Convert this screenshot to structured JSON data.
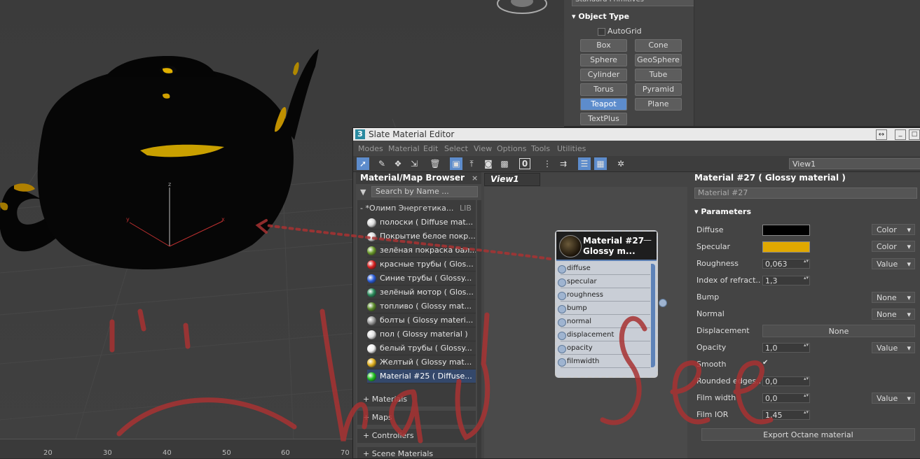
{
  "ruler": {
    "labels": [
      "20",
      "30",
      "40",
      "50",
      "60",
      "70"
    ]
  },
  "command_panel": {
    "primitives_dropdown": "Standard Primitives",
    "object_type_header": "Object Type",
    "autogrid_label": "AutoGrid",
    "buttons": [
      {
        "label": "Box",
        "active": false
      },
      {
        "label": "Cone",
        "active": false
      },
      {
        "label": "Sphere",
        "active": false
      },
      {
        "label": "GeoSphere",
        "active": false
      },
      {
        "label": "Cylinder",
        "active": false
      },
      {
        "label": "Tube",
        "active": false
      },
      {
        "label": "Torus",
        "active": false
      },
      {
        "label": "Pyramid",
        "active": false
      },
      {
        "label": "Teapot",
        "active": true
      },
      {
        "label": "Plane",
        "active": false
      },
      {
        "label": "TextPlus",
        "active": false
      }
    ]
  },
  "slate": {
    "app_icon": "3",
    "title": "Slate Material Editor",
    "menu": [
      "Modes",
      "Material",
      "Edit",
      "Select",
      "View",
      "Options",
      "Tools",
      "Utilities"
    ],
    "toolbar_icons": [
      "select-arrow-icon",
      "eyedropper-icon",
      "pick-material-icon",
      "assign-material-icon",
      "delete-icon",
      "move-children-icon",
      "hide-unused-icon",
      "show-map-icon",
      "background-icon",
      "zero-icon",
      "layout-icon",
      "layout-children-icon",
      "material-map-browser-icon",
      "parameter-editor-icon",
      "select-by-material-icon"
    ],
    "view_dropdown": "View1",
    "browser": {
      "title": "Material/Map Browser",
      "search_placeholder": "Search by Name ...",
      "library_name": "- *Олимп Энергетика...",
      "library_tag": "LIB",
      "items": [
        {
          "label": "полоски  ( Diffuse mat...",
          "color": "#d8d8d8",
          "selected": false
        },
        {
          "label": "Покрытие белое покр...",
          "color": "#dcdcdc",
          "selected": false
        },
        {
          "label": "зелёная покраска бал...",
          "color": "#6a9a2a",
          "selected": false
        },
        {
          "label": "красные трубы  ( Glos...",
          "color": "#d82020",
          "selected": false
        },
        {
          "label": "Синие трубы  ( Glossy...",
          "color": "#2a5cd8",
          "selected": false
        },
        {
          "label": "зелёный мотор  ( Glos...",
          "color": "#2a8a5a",
          "selected": false
        },
        {
          "label": "топливо  ( Glossy mat...",
          "color": "#5a8a2a",
          "selected": false
        },
        {
          "label": "болты  ( Glossy materi...",
          "color": "#9a9a9a",
          "selected": false
        },
        {
          "label": "пол  ( Glossy material )",
          "color": "#e0e0e0",
          "selected": false
        },
        {
          "label": "белый трубы  ( Glossy...",
          "color": "#eeeeee",
          "selected": false
        },
        {
          "label": "Желтый  ( Glossy mat...",
          "color": "#e0b020",
          "selected": false
        },
        {
          "label": "Material #25  ( Diffuse...",
          "color": "#20c020",
          "selected": true
        }
      ],
      "sections": [
        "+ Materials",
        "+ Maps",
        "+ Controllers",
        "+ Scene Materials"
      ]
    },
    "view_tab": "View1",
    "node": {
      "title_line1": "Material #27",
      "title_line2": "Glossy m...",
      "minimize": "—",
      "slots": [
        "diffuse",
        "specular",
        "roughness",
        "bump",
        "normal",
        "displacement",
        "opacity",
        "filmwidth"
      ]
    },
    "params": {
      "title": "Material #27  ( Glossy material )",
      "name_field": "Material #27",
      "section": "Parameters",
      "rows": {
        "diffuse": {
          "label": "Diffuse",
          "color": "#000000",
          "mode": "Color"
        },
        "specular": {
          "label": "Specular",
          "color": "#e0a800",
          "mode": "Color"
        },
        "roughness": {
          "label": "Roughness",
          "value": "0,063",
          "mode": "Value"
        },
        "ior": {
          "label": "Index of refract...",
          "value": "1,3"
        },
        "bump": {
          "label": "Bump",
          "mode": "None"
        },
        "normal": {
          "label": "Normal",
          "mode": "None"
        },
        "displacement": {
          "label": "Displacement",
          "button": "None"
        },
        "opacity": {
          "label": "Opacity",
          "value": "1,0",
          "mode": "Value"
        },
        "smooth": {
          "label": "Smooth",
          "check": "✔"
        },
        "rounded": {
          "label": "Rounded edges...",
          "value": "0,0"
        },
        "film_width": {
          "label": "Film width",
          "value": "0,0",
          "mode": "Value"
        },
        "film_ior": {
          "label": "Film IOR",
          "value": "1,45"
        }
      },
      "export_button": "Export Octane material"
    }
  },
  "colors": {
    "accent": "#5d8ccc",
    "annotation": "#b03030",
    "highlight": "#e0a800"
  }
}
